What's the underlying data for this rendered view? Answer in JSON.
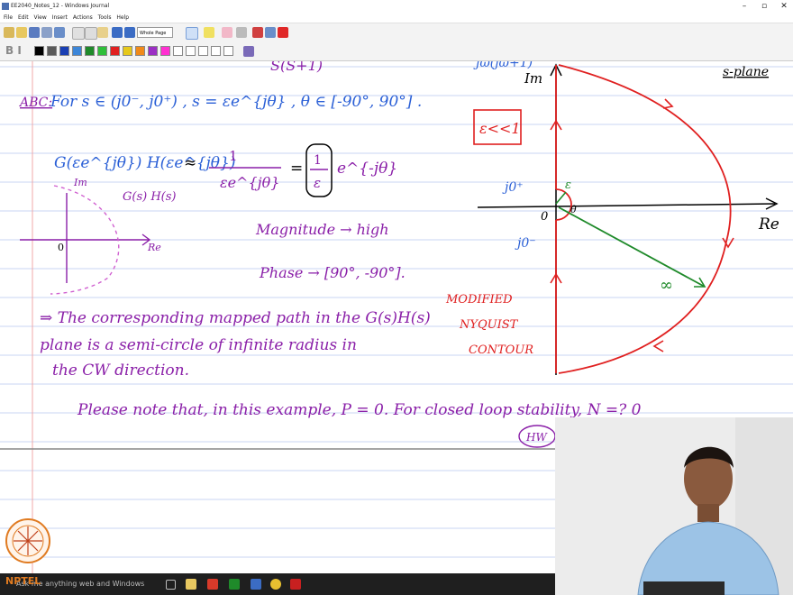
{
  "window": {
    "title": "EE2040_Notes_12 - Windows Journal",
    "controls": [
      "–",
      "▫",
      "✕"
    ]
  },
  "menu": [
    "File",
    "Edit",
    "View",
    "Insert",
    "Actions",
    "Tools",
    "Help"
  ],
  "toolbar": {
    "zoom_select": "Whole Page",
    "pen_colors": [
      "#000000",
      "#5a5a5a",
      "#1a3fb3",
      "#3c86d8",
      "#1f8a2a",
      "#2fbf3a",
      "#e02020",
      "#e6c81a",
      "#f08a1a",
      "#9b2fc4",
      "#ff2fd1",
      "#ffffff",
      "#ffffff",
      "#ffffff",
      "#ffffff",
      "#ffffff"
    ],
    "format_label": "B I"
  },
  "notes": {
    "top_fragment_left": "S(S+1)",
    "top_fragment_right": "jω(jω+1)",
    "im_label": "Im",
    "re_label": "Re",
    "s_plane": "s-plane",
    "abc_label": "ABC:",
    "condition": "For s ∈ (j0⁻, j0⁺) , s = εe^{jθ} , θ ∈ [-90°, 90°] .",
    "epsilon_box": "ε<<1",
    "g_lhs": "G(εe^{jθ}) H(εe^{jθ})",
    "approx": "≈",
    "frac_num": "1",
    "frac_den": "εe^{jθ}",
    "equals": "=",
    "boxed_num": "1",
    "boxed_den": "ε",
    "exp_term": "e^{-jθ}",
    "inset_im": "Im",
    "inset_re": "Re",
    "inset_zero": "0",
    "inset_label": "G(s) H(s)",
    "magnitude": "Magnitude → high",
    "phase": "Phase → [90°, -90°].",
    "j0plus": "j0⁺",
    "j0minus": "j0⁻",
    "origin": "0",
    "eps": "ε",
    "theta": "θ",
    "infinity": "∞",
    "modified_1": "MODIFIED",
    "modified_2": "NYQUIST",
    "modified_3": "CONTOUR",
    "para_line1": "⇒ The corresponding mapped path in the G(s)H(s)",
    "para_line2": "plane is a semi-circle of infinite radius in",
    "para_line3": "the CW direction.",
    "bottom_line": "Please note that, in this example, P = 0. For closed loop stability, N =? 0",
    "hw": "HW"
  },
  "taskbar": {
    "search_placeholder": "Ask me anything  web and Windows"
  },
  "logo_text": "NPTEL",
  "colors": {
    "blue_ink": "#2a5fd6",
    "purple_ink": "#8a1fa8",
    "red_ink": "#e02020",
    "green_ink": "#1f8a2a",
    "rule_line": "#c9d6f3",
    "margin_line": "#f0a8a8"
  }
}
